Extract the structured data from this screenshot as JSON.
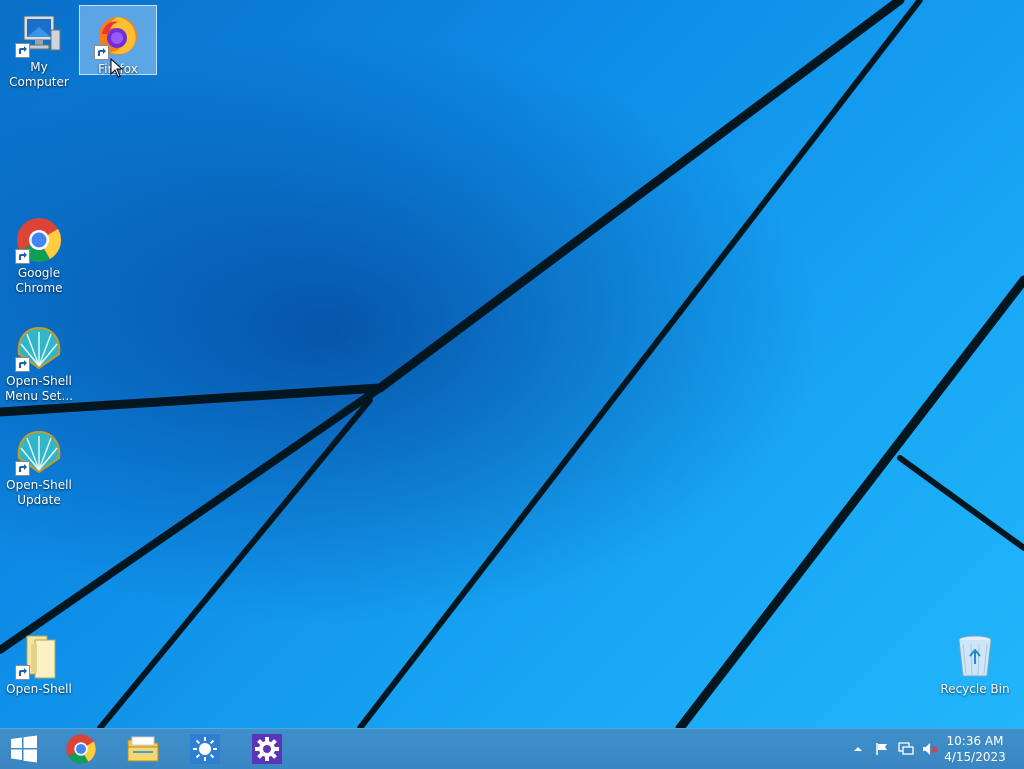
{
  "desktop": {
    "icons": [
      {
        "label": "My Computer"
      },
      {
        "label": "Firefox"
      },
      {
        "label": "Google Chrome"
      },
      {
        "label": "Open-Shell Menu Set..."
      },
      {
        "label": "Open-Shell Update"
      },
      {
        "label": "Open-Shell"
      },
      {
        "label": "Recycle Bin"
      }
    ]
  },
  "taskbar": {
    "pinned": [
      {
        "icon": "chrome-icon"
      },
      {
        "icon": "file-explorer-icon"
      },
      {
        "icon": "brightness-app-icon"
      },
      {
        "icon": "settings-gear-icon"
      }
    ],
    "tray": {
      "icons": [
        "show-hidden-icons-chevron",
        "action-center-flag-icon",
        "network-icon",
        "volume-muted-icon"
      ]
    },
    "clock": {
      "time": "10:36 AM",
      "date": "4/15/2023"
    }
  },
  "colors": {
    "desktop": "#0c8fe0",
    "taskbar": "#3a86c2",
    "selection": "#bee1ff"
  }
}
